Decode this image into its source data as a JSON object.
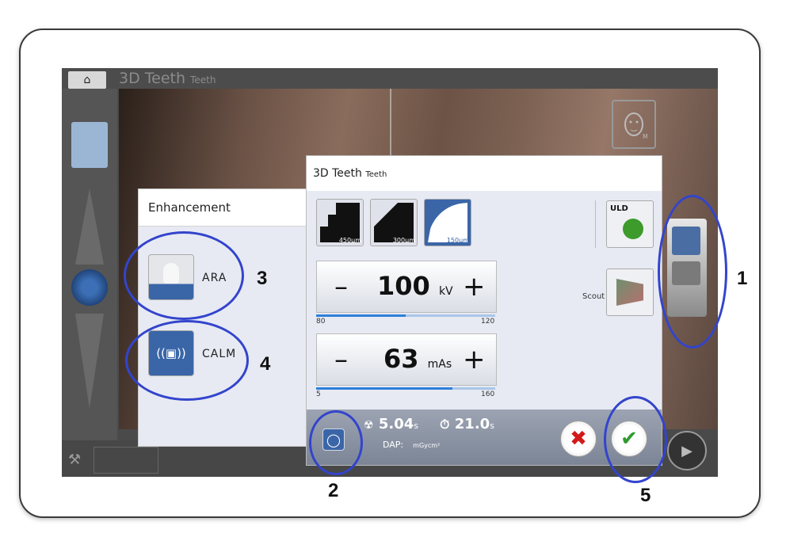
{
  "app": {
    "title": "3D Teeth",
    "subtitle": "Teeth"
  },
  "enhancement": {
    "title": "Enhancement",
    "options": [
      {
        "label": "ARA",
        "icon": "ara-icon"
      },
      {
        "label": "CALM",
        "icon": "calm-icon"
      }
    ]
  },
  "dialog": {
    "title": "3D Teeth",
    "subtitle": "Teeth",
    "resolutions": [
      {
        "label": "450µm",
        "selected": false
      },
      {
        "label": "300µm",
        "selected": false
      },
      {
        "label": "150µm",
        "selected": true
      }
    ],
    "uld_label": "ULD",
    "scout_label": "Scout",
    "kv": {
      "minus": "–",
      "value": "100",
      "unit": "kV",
      "plus": "+",
      "min": "80",
      "max": "120",
      "level_fraction": 0.5
    },
    "mas": {
      "minus": "–",
      "value": "63",
      "unit": "mAs",
      "plus": "+",
      "min": "5",
      "max": "160",
      "level_fraction": 0.76
    },
    "exposure_time": "5.04",
    "exposure_unit": "s",
    "total_time": "21.0",
    "total_unit": "s",
    "dap_label": "DAP:",
    "dap_unit": "mGycm²"
  },
  "annotations": [
    "1",
    "2",
    "3",
    "4",
    "5"
  ],
  "colors": {
    "ring": "#3344cc",
    "accent": "#3a66a8",
    "cancel": "#d21a1a",
    "confirm": "#2f9a2f"
  }
}
